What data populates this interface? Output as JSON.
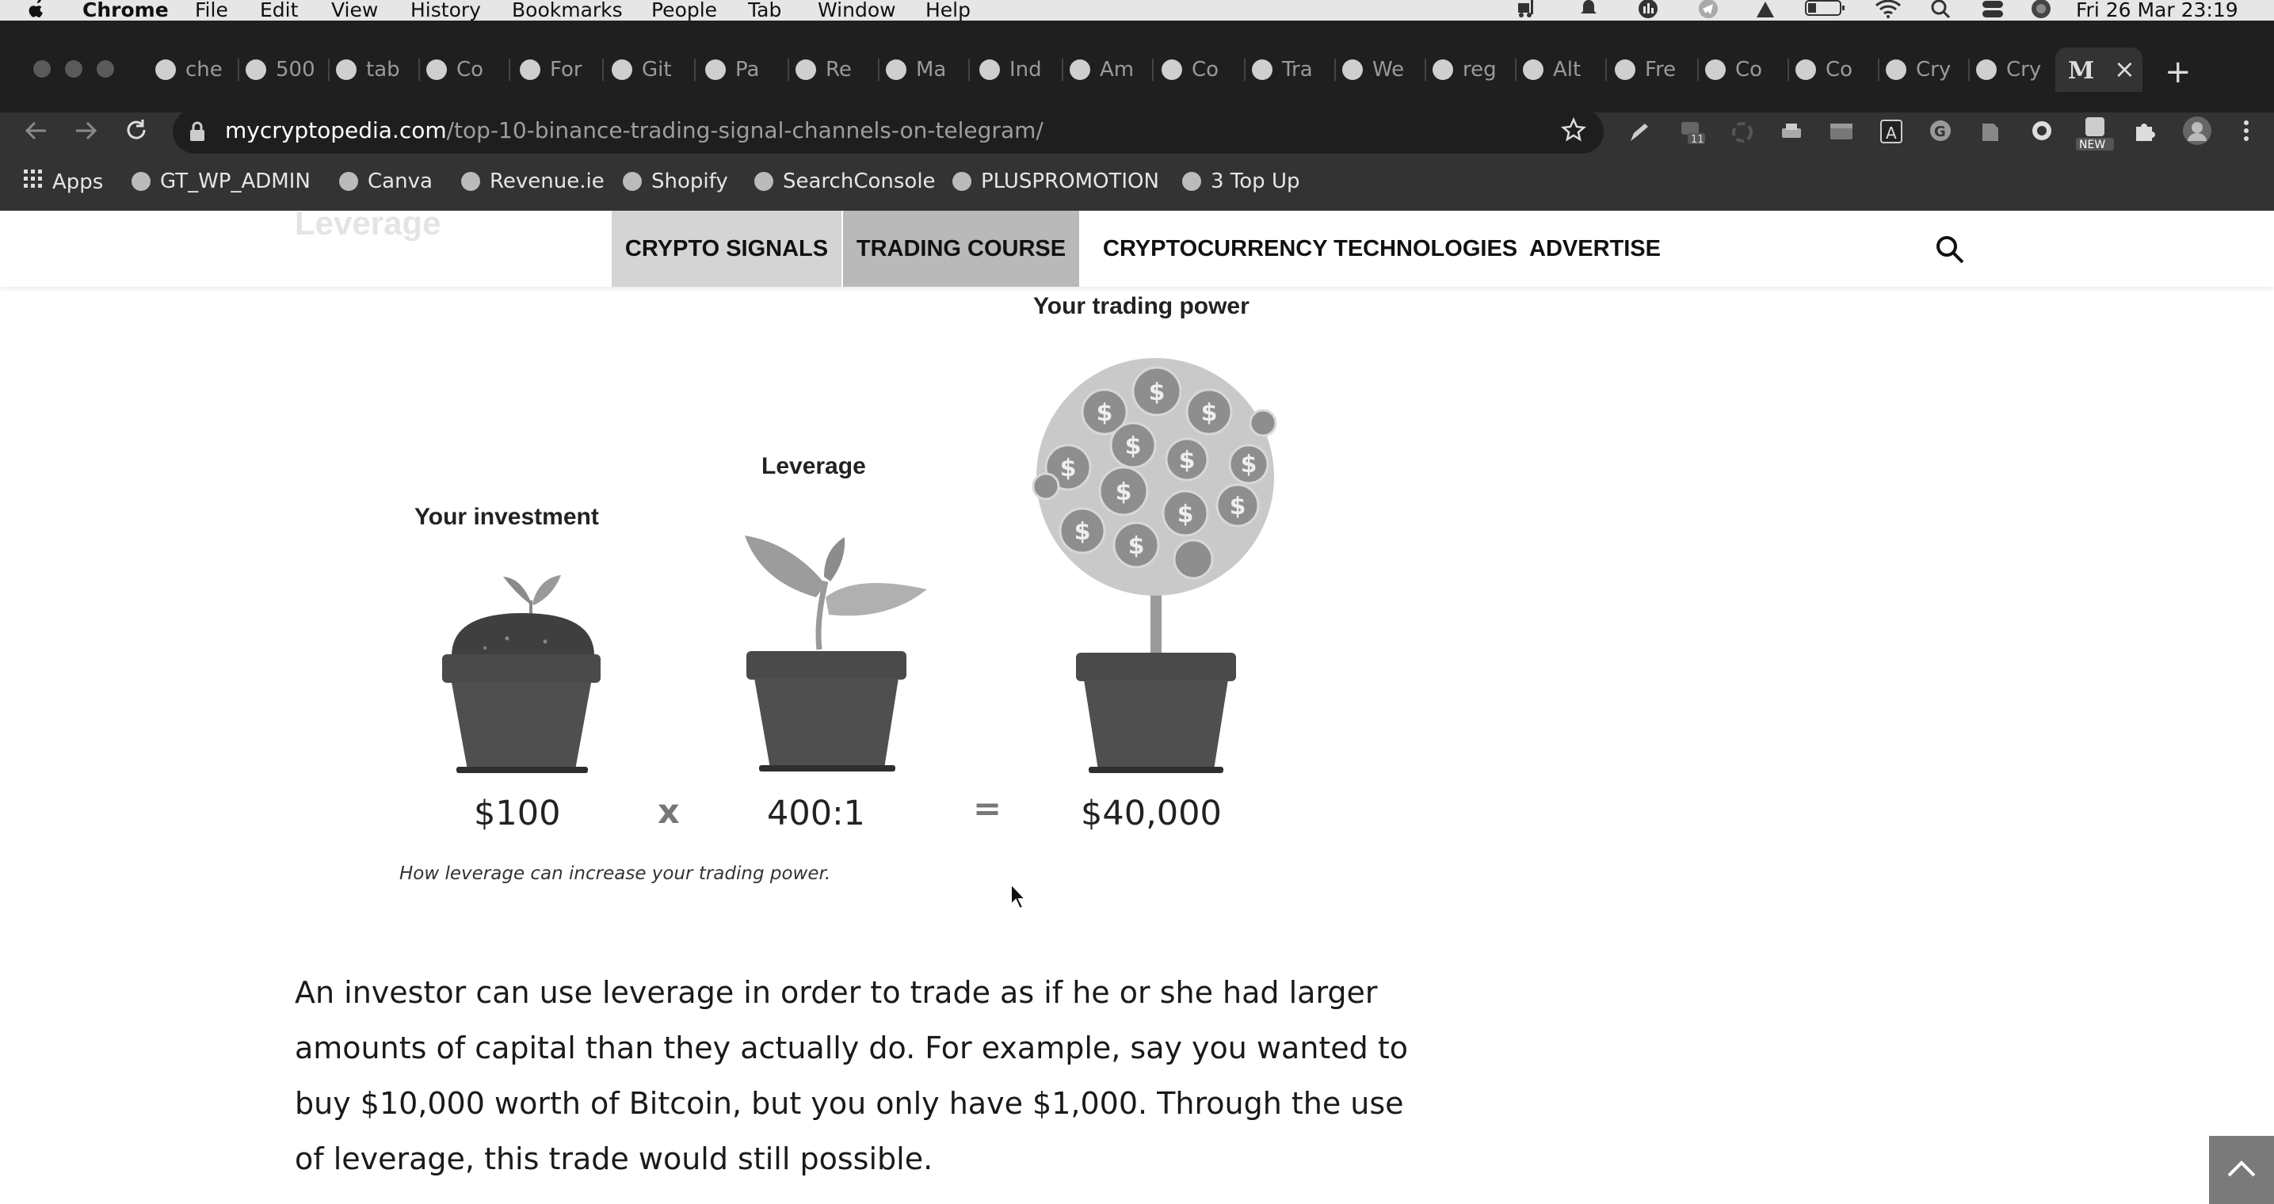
{
  "menubar": {
    "apple_icon": "apple-icon",
    "items": [
      "Chrome",
      "File",
      "Edit",
      "View",
      "History",
      "Bookmarks",
      "People",
      "Tab",
      "Window",
      "Help"
    ],
    "clock": "Fri 26 Mar  23:19"
  },
  "tabs": [
    {
      "label": "che",
      "icon": "google-icon"
    },
    {
      "label": "500",
      "icon": "chart-icon"
    },
    {
      "label": "tab",
      "icon": "google-icon"
    },
    {
      "label": "Co",
      "icon": "stack-icon"
    },
    {
      "label": "For",
      "icon": "grid-icon"
    },
    {
      "label": "Git",
      "icon": "github-icon"
    },
    {
      "label": "Pa",
      "icon": "globe-icon"
    },
    {
      "label": "Re",
      "icon": "github-icon"
    },
    {
      "label": "Ma",
      "icon": "cube-icon"
    },
    {
      "label": "Ind",
      "icon": "info-icon"
    },
    {
      "label": "Am",
      "icon": "amazon-icon"
    },
    {
      "label": "Co",
      "icon": "google-icon"
    },
    {
      "label": "Tra",
      "icon": "amazon-icon"
    },
    {
      "label": "We",
      "icon": "shield-icon"
    },
    {
      "label": "reg",
      "icon": "stack-icon"
    },
    {
      "label": "Alt",
      "icon": "square-icon"
    },
    {
      "label": "Fre",
      "icon": "square-icon"
    },
    {
      "label": "Co",
      "icon": "search-icon"
    },
    {
      "label": "Co",
      "icon": "leaf-icon"
    },
    {
      "label": "Cry",
      "icon": "medium-icon"
    },
    {
      "label": "Cry",
      "icon": "medium-icon"
    }
  ],
  "active_tab": {
    "icon": "M",
    "close": "×"
  },
  "new_tab": "+",
  "address": {
    "domain": "mycryptopedia.com",
    "path": "/top-10-binance-trading-signal-channels-on-telegram/"
  },
  "bookmarks": [
    "Apps",
    "GT_WP_ADMIN",
    "Canva",
    "Revenue.ie",
    "Shopify",
    "SearchConsole",
    "PLUSPROMOTION",
    "3 Top Up"
  ],
  "site": {
    "faded_heading": "Leverage",
    "nav": [
      "CRYPTO SIGNALS",
      "TRADING COURSE",
      "CRYPTOCURRENCY TECHNOLOGIES",
      "ADVERTISE"
    ]
  },
  "illustration": {
    "label_investment": "Your investment",
    "label_leverage": "Leverage",
    "label_power": "Your trading power",
    "amount_investment": "$100",
    "operator_times": "x",
    "amount_leverage": "400:1",
    "operator_equals": "=",
    "amount_power": "$40,000"
  },
  "caption": "How leverage can increase your trading power.",
  "body_text": "An investor can use leverage in order to trade as if he or she had larger amounts of capital than they actually do. For example, say you wanted to buy $10,000 worth of Bitcoin, but you only have $1,000. Through the use of leverage, this trade would still possible."
}
